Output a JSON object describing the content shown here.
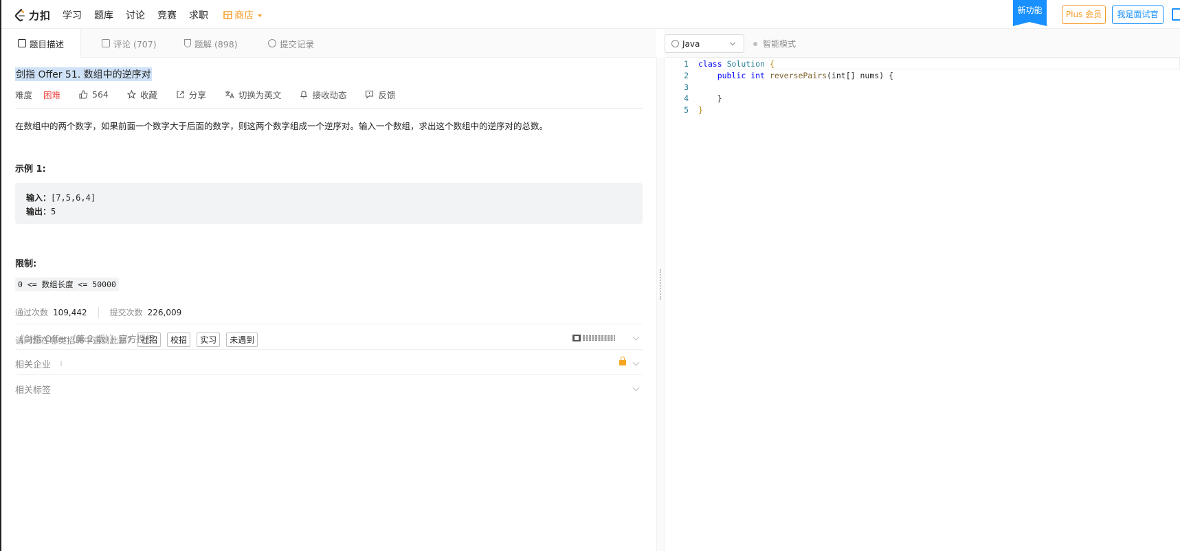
{
  "nav": {
    "logo_text": "力扣",
    "links": [
      "学习",
      "题库",
      "讨论",
      "竞赛",
      "求职"
    ],
    "shop": "商店",
    "new_feature": "新功能",
    "plus": "Plus 会员",
    "interviewer": "我是面试官"
  },
  "tabs": [
    {
      "label": "题目描述"
    },
    {
      "label": "评论 (707)"
    },
    {
      "label": "题解 (898)"
    },
    {
      "label": "提交记录"
    }
  ],
  "problem": {
    "title": "剑指 Offer 51. 数组中的逆序对",
    "difficulty_label": "难度",
    "difficulty": "困难",
    "likes": "564",
    "favorite": "收藏",
    "share": "分享",
    "switch_lang": "切换为英文",
    "subscribe": "接收动态",
    "feedback": "反馈",
    "description": "在数组中的两个数字，如果前面一个数字大于后面的数字，则这两个数字组成一个逆序对。输入一个数组，求出这个数组中的逆序对的总数。",
    "example_title": "示例 1:",
    "example_input_label": "输入",
    "example_input": "[7,5,6,4]",
    "example_output_label": "输出",
    "example_output": "5",
    "limit_title": "限制:",
    "limit": "0 <= 数组长度 <= 50000",
    "accepted_label": "通过次数",
    "accepted": "109,442",
    "submissions_label": "提交次数",
    "submissions": "226,009",
    "survey_question": "请问您在哪类招聘中遇到此题?",
    "survey_options": [
      "社招",
      "校招",
      "实习",
      "未遇到"
    ],
    "book_section": "《剑指 Offer（第 2 版）》官方授权",
    "companies_section": "相关企业",
    "tags_section": "相关标签"
  },
  "editor": {
    "language": "Java",
    "smart_mode": "智能模式",
    "lines": [
      {
        "n": "1"
      },
      {
        "n": "2"
      },
      {
        "n": "3"
      },
      {
        "n": "4"
      },
      {
        "n": "5"
      }
    ],
    "code": {
      "kw_class": "class",
      "class_name": "Solution",
      "kw_public": "public",
      "kw_int": "int",
      "method": "reversePairs",
      "param": "int[] nums",
      "open_brace": "{",
      "close_brace": "}"
    }
  }
}
